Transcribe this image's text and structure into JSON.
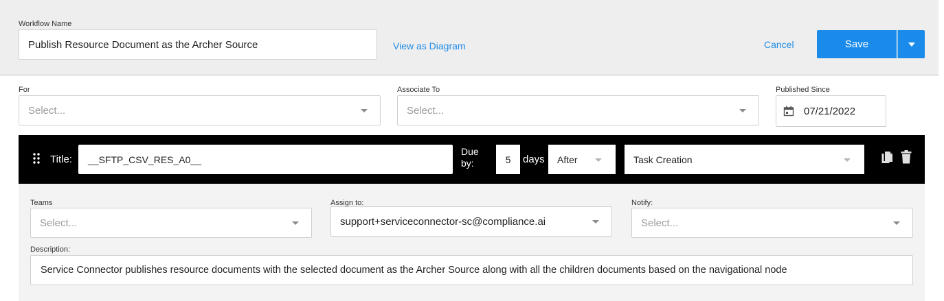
{
  "workflow": {
    "name_label": "Workflow Name",
    "name_value": "Publish Resource Document as the Archer Source",
    "view_diagram_link": "View as Diagram",
    "cancel_link": "Cancel",
    "save_label": "Save"
  },
  "filters": {
    "for_label": "For",
    "for_placeholder": "Select...",
    "associate_label": "Associate To",
    "associate_placeholder": "Select...",
    "published_label": "Published Since",
    "published_value": "07/21/2022"
  },
  "task": {
    "title_label": "Title:",
    "title_value": "__SFTP_CSV_RES_A0__",
    "due_line1": "Due",
    "due_line2": "by:",
    "due_value": "5",
    "days_label": "days",
    "relation_value": "After",
    "trigger_value": "Task Creation",
    "teams_label": "Teams",
    "teams_placeholder": "Select...",
    "assign_label": "Assign to:",
    "assign_value": "support+serviceconnector-sc@compliance.ai",
    "notify_label": "Notify:",
    "notify_placeholder": "Select...",
    "description_label": "Description:",
    "description_value": "Service Connector publishes resource documents with the selected document as the Archer Source along with all the children documents based on the navigational node"
  },
  "colors": {
    "accent": "#1a8bea",
    "link": "#1f8ce8",
    "task_bar": "#000000",
    "header_bg": "#eeeeee"
  },
  "icons": [
    "drag-handle-icon",
    "calendar-icon",
    "copy-icon",
    "trash-icon",
    "chevron-down-icon"
  ]
}
